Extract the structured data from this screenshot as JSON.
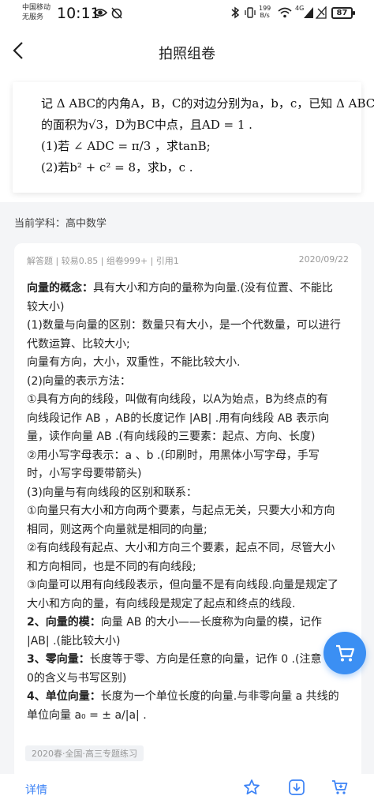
{
  "status": {
    "carrier_line1": "中国移动",
    "carrier_line2": "无服务",
    "time": "10:11",
    "net_speed": "199",
    "net_unit": "B/s",
    "signal_label": "4G",
    "battery": "87"
  },
  "navbar": {
    "back_glyph": "‹",
    "title": "拍照组卷"
  },
  "question": {
    "line1": "记 Δ ABC的内角A，B，C的对边分别为a，b，c，已知 Δ ABC",
    "line2": "的面积为√3，D为BC中点，且AD = 1 .",
    "line3": "(1)若 ∠ ADC = π/3 ，求tanB;",
    "line4": "(2)若b² + c² = 8，求b，c ."
  },
  "subject": "当前学科：高中数学",
  "answer": {
    "meta": "解答题 | 较易0.85 | 组卷999+ | 引用1",
    "date": "2020/09/22",
    "lines": [
      {
        "bold": "向量的概念：",
        "text": "具有大小和方向的量称为向量.(没有位置、不能比"
      },
      {
        "bold": "",
        "text": "较大小)"
      },
      {
        "bold": "",
        "text": "(1)数量与向量的区别：数量只有大小，是一个代数量，可以进行"
      },
      {
        "bold": "",
        "text": "代数运算、比较大小;"
      },
      {
        "bold": "",
        "text": "向量有方向，大小，双重性，不能比较大小."
      },
      {
        "bold": "",
        "text": "(2)向量的表示方法："
      },
      {
        "bold": "",
        "text": "①具有方向的线段，叫做有向线段，以A为始点，B为终点的有"
      },
      {
        "bold": "",
        "text": "向线段记作 AB ，AB的长度记作 |AB| .用有向线段 AB 表示向"
      },
      {
        "bold": "",
        "text": "量，读作向量 AB .(有向线段的三要素：起点、方向、长度)"
      },
      {
        "bold": "",
        "text": "②用小写字母表示：a 、b .(印刷时，用黑体小写字母，手写"
      },
      {
        "bold": "",
        "text": "时，小写字母要带箭头)"
      },
      {
        "bold": "",
        "text": "(3)向量与有向线段的区别和联系："
      },
      {
        "bold": "",
        "text": "①向量只有大小和方向两个要素，与起点无关，只要大小和方向"
      },
      {
        "bold": "",
        "text": "相同，则这两个向量就是相同的向量;"
      },
      {
        "bold": "",
        "text": "②有向线段有起点、大小和方向三个要素，起点不同，尽管大小"
      },
      {
        "bold": "",
        "text": "和方向相同，也是不同的有向线段;"
      },
      {
        "bold": "",
        "text": "③向量可以用有向线段表示，但向量不是有向线段.向量是规定了"
      },
      {
        "bold": "",
        "text": "大小和方向的量，有向线段是规定了起点和终点的线段."
      },
      {
        "bold": "2、向量的模：",
        "text": "向量 AB 的大小——长度称为向量的模，记作"
      },
      {
        "bold": "",
        "text": "|AB| .(能比较大小)"
      },
      {
        "bold": "3、零向量：",
        "text": "长度等于零、方向是任意的向量，记作 0 .(注意"
      },
      {
        "bold": "",
        "text": "0的含义与书写区别)"
      },
      {
        "bold": "4、单位向量：",
        "text": "长度为一个单位长度的向量.与非零向量 a 共线的"
      },
      {
        "bold": "",
        "text": "单位向量 a₀ = ± a/|a| ."
      }
    ],
    "tag": "2020春·全国·高三专题练习"
  },
  "bottom": {
    "detail_label": "详情"
  },
  "colors": {
    "accent": "#3b82f6",
    "fab": "#3b8ff3"
  }
}
